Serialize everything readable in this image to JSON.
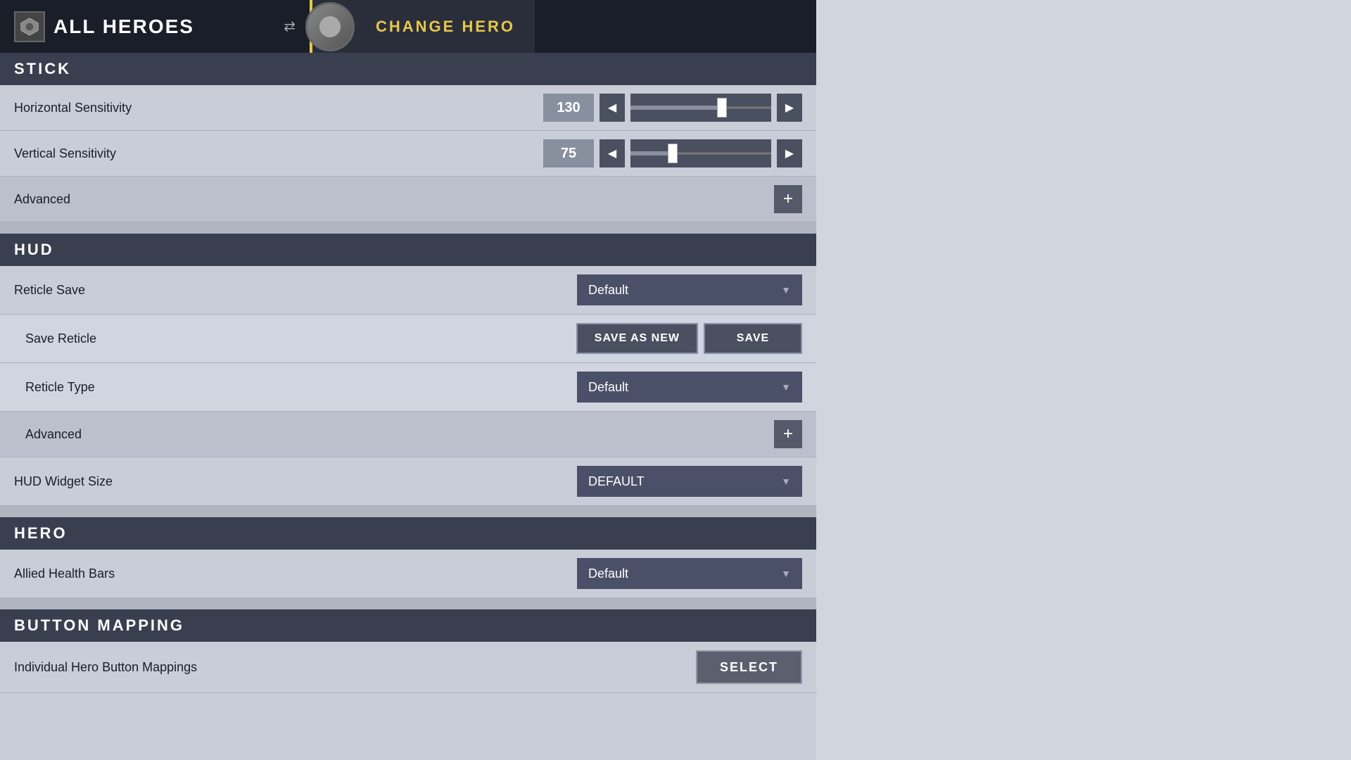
{
  "header": {
    "all_heroes_label": "ALL HEROES",
    "change_hero_label": "CHANGE HERO"
  },
  "stick": {
    "section_label": "STICK",
    "horizontal_sensitivity": {
      "label": "Horizontal Sensitivity",
      "value": "130",
      "slider_percent": 65
    },
    "vertical_sensitivity": {
      "label": "Vertical Sensitivity",
      "value": "75",
      "slider_percent": 35
    },
    "advanced_label": "Advanced"
  },
  "hud": {
    "section_label": "HUD",
    "reticle_save": {
      "label": "Reticle Save",
      "value": "Default"
    },
    "save_reticle": {
      "label": "Save Reticle",
      "save_as_new": "SAVE AS NEW",
      "save": "SAVE"
    },
    "reticle_type": {
      "label": "Reticle Type",
      "value": "Default"
    },
    "advanced_label": "Advanced",
    "hud_widget_size": {
      "label": "HUD Widget Size",
      "value": "DEFAULT"
    }
  },
  "hero": {
    "section_label": "HERO",
    "allied_health_bars": {
      "label": "Allied Health Bars",
      "value": "Default"
    }
  },
  "button_mapping": {
    "section_label": "BUTTON MAPPING",
    "individual_hero": {
      "label": "Individual Hero Button Mappings",
      "select_label": "SELECT"
    }
  }
}
